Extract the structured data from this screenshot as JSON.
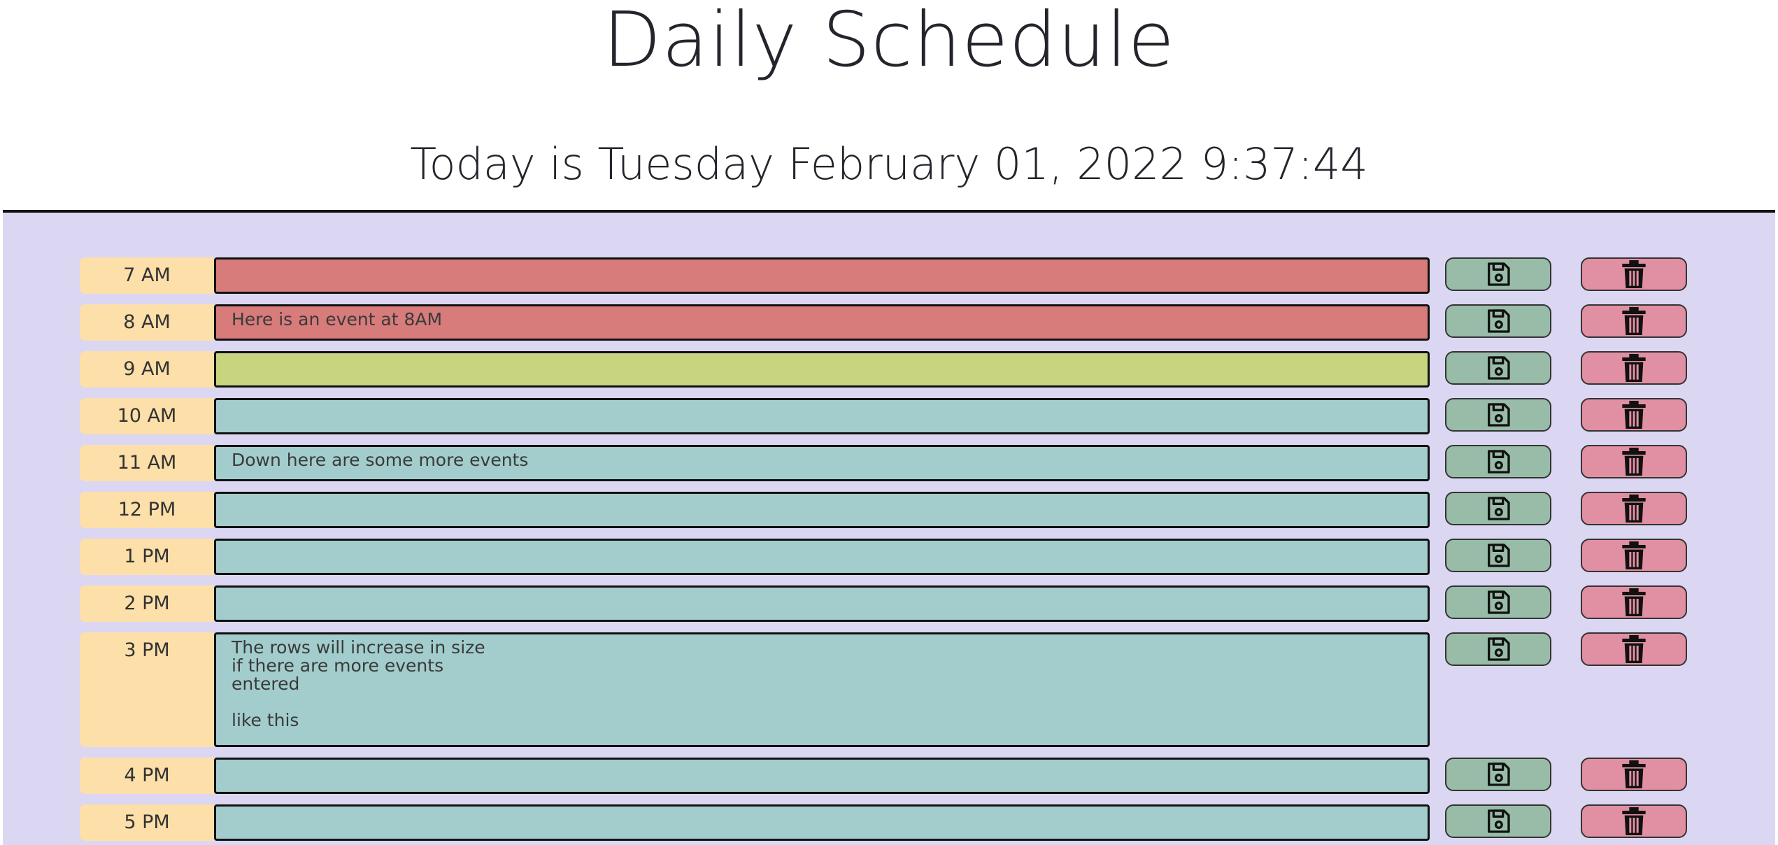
{
  "header": {
    "title": "Daily Schedule",
    "date_text": "Today is Tuesday February 01, 2022 9:37:44"
  },
  "icons": {
    "save": "floppy-disk-icon",
    "delete": "trash-icon"
  },
  "colors": {
    "past": "#d77b7b",
    "present": "#c8d47e",
    "future": "#a2cdcc",
    "hour_label_bg": "#fddfaa",
    "save_button": "#98bca8",
    "delete_button": "#e18fa3",
    "background": "#dbd7f2"
  },
  "rows": [
    {
      "hour": "7 AM",
      "status": "past",
      "text": ""
    },
    {
      "hour": "8 AM",
      "status": "past",
      "text": "Here is an event at 8AM"
    },
    {
      "hour": "9 AM",
      "status": "present",
      "text": ""
    },
    {
      "hour": "10 AM",
      "status": "future",
      "text": ""
    },
    {
      "hour": "11 AM",
      "status": "future",
      "text": "Down here are some more events"
    },
    {
      "hour": "12 PM",
      "status": "future",
      "text": ""
    },
    {
      "hour": "1 PM",
      "status": "future",
      "text": ""
    },
    {
      "hour": "2 PM",
      "status": "future",
      "text": ""
    },
    {
      "hour": "3 PM",
      "status": "future",
      "text": "The rows will increase in size\nif there are more events\nentered\n\nlike this"
    },
    {
      "hour": "4 PM",
      "status": "future",
      "text": ""
    },
    {
      "hour": "5 PM",
      "status": "future",
      "text": ""
    }
  ]
}
